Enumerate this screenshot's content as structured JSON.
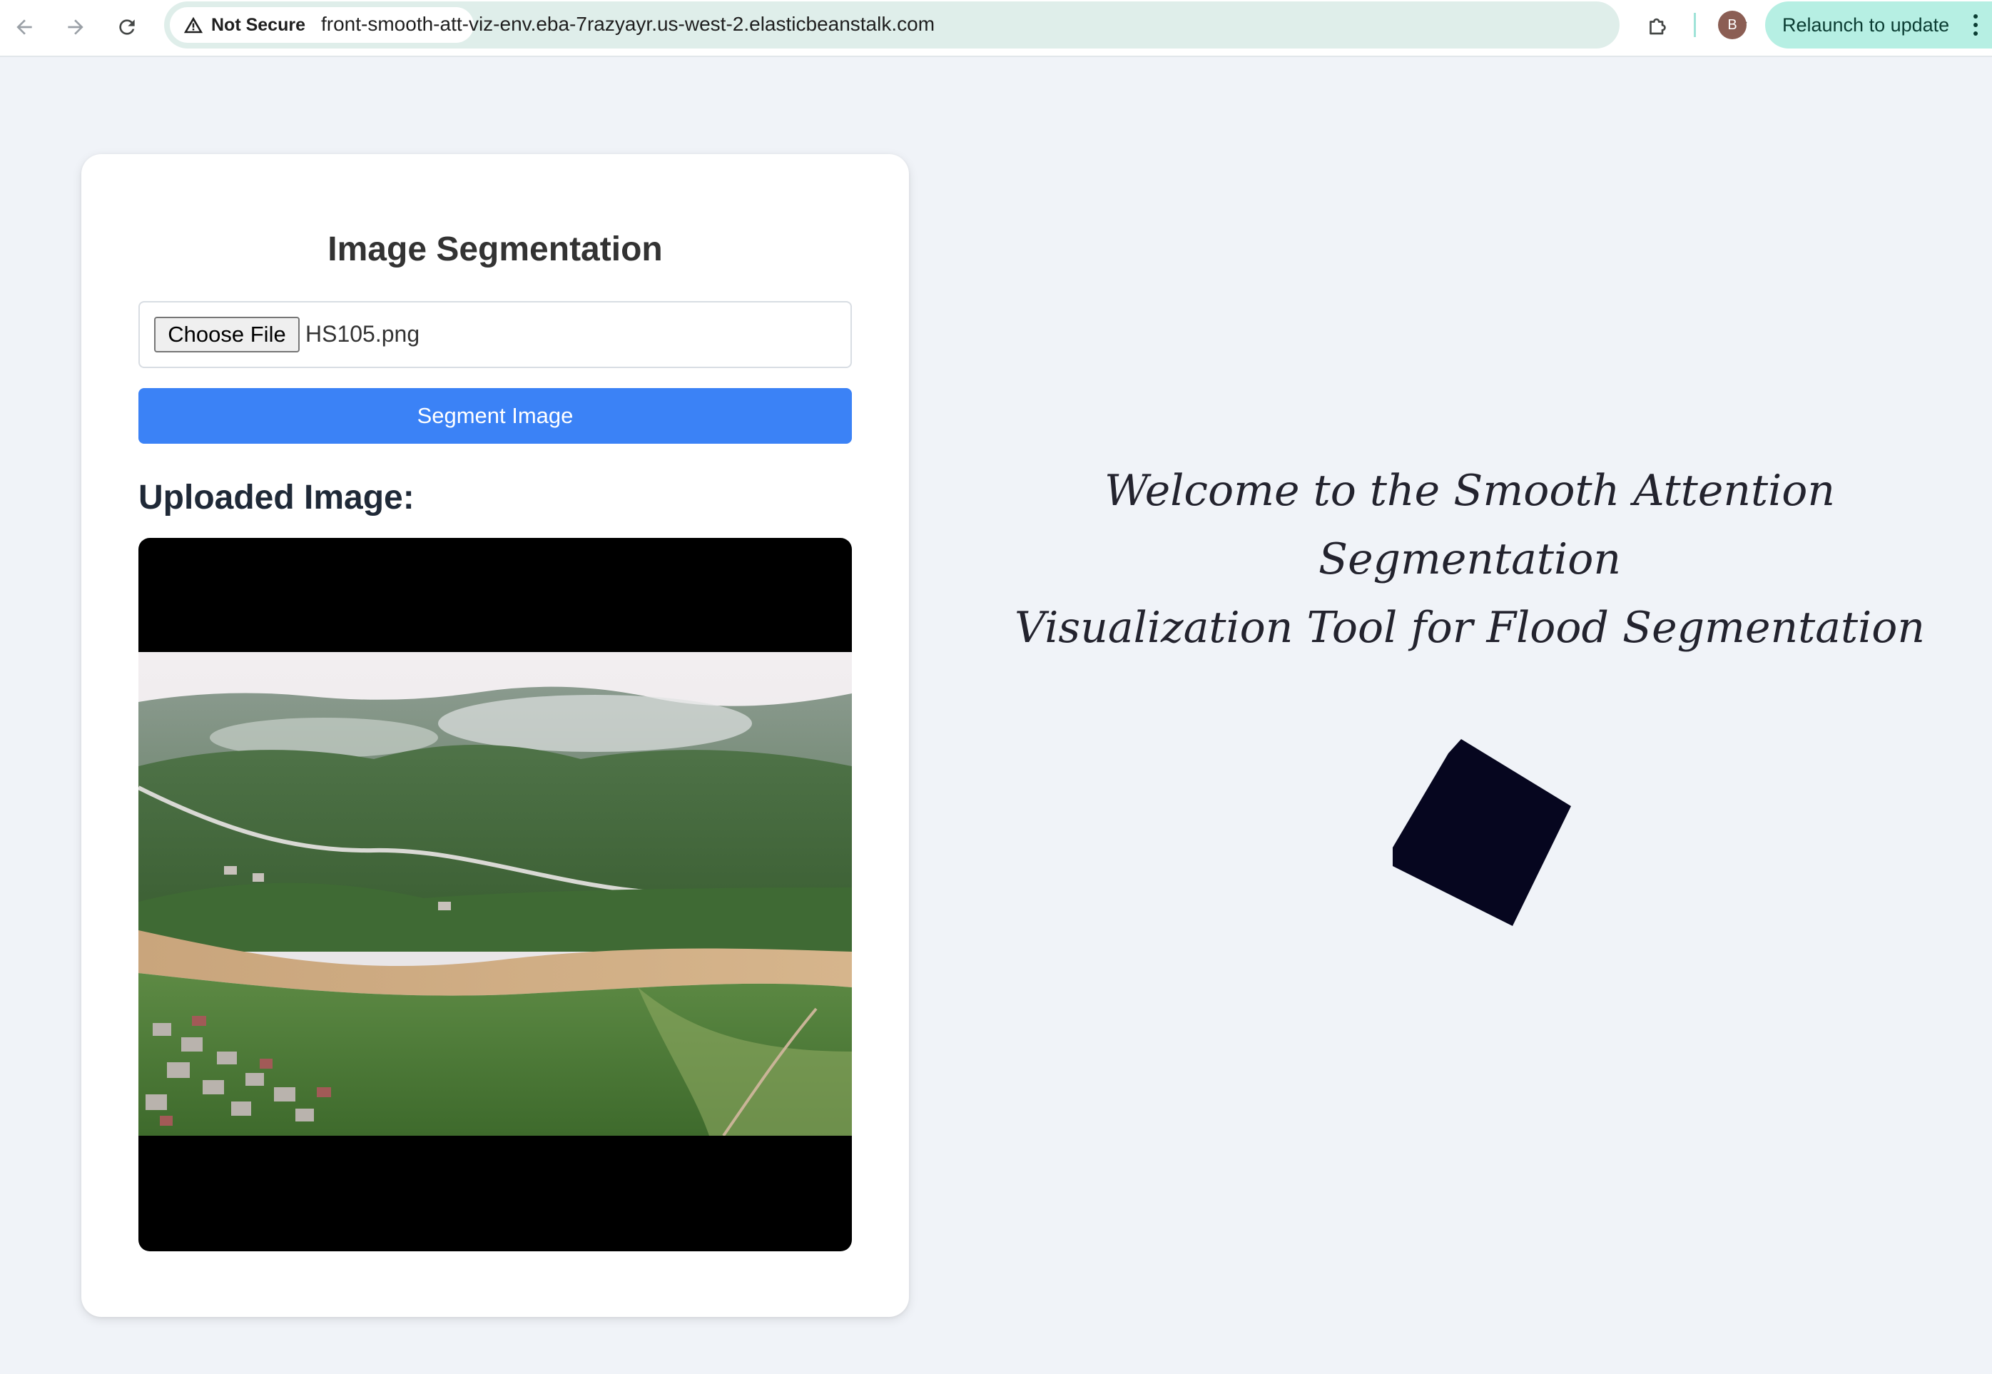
{
  "browser": {
    "security_label": "Not Secure",
    "url": "front-smooth-att-viz-env.eba-7razyayr.us-west-2.elasticbeanstalk.com",
    "profile_initial": "B",
    "relaunch_label": "Relaunch to update"
  },
  "page": {
    "card_title": "Image Segmentation",
    "file_button_label": "Choose File",
    "file_name": "HS105.png",
    "segment_button_label": "Segment Image",
    "uploaded_label": "Uploaded Image:",
    "welcome_line1": "Welcome to the Smooth Attention Segmentation",
    "welcome_line2": "Visualization Tool for Flood Segmentation"
  },
  "colors": {
    "page_bg": "#f0f3f8",
    "primary_button": "#3b82f6",
    "cube": "#06061f",
    "omnibox": "#dfeeea",
    "relaunch": "#b6efe3"
  }
}
